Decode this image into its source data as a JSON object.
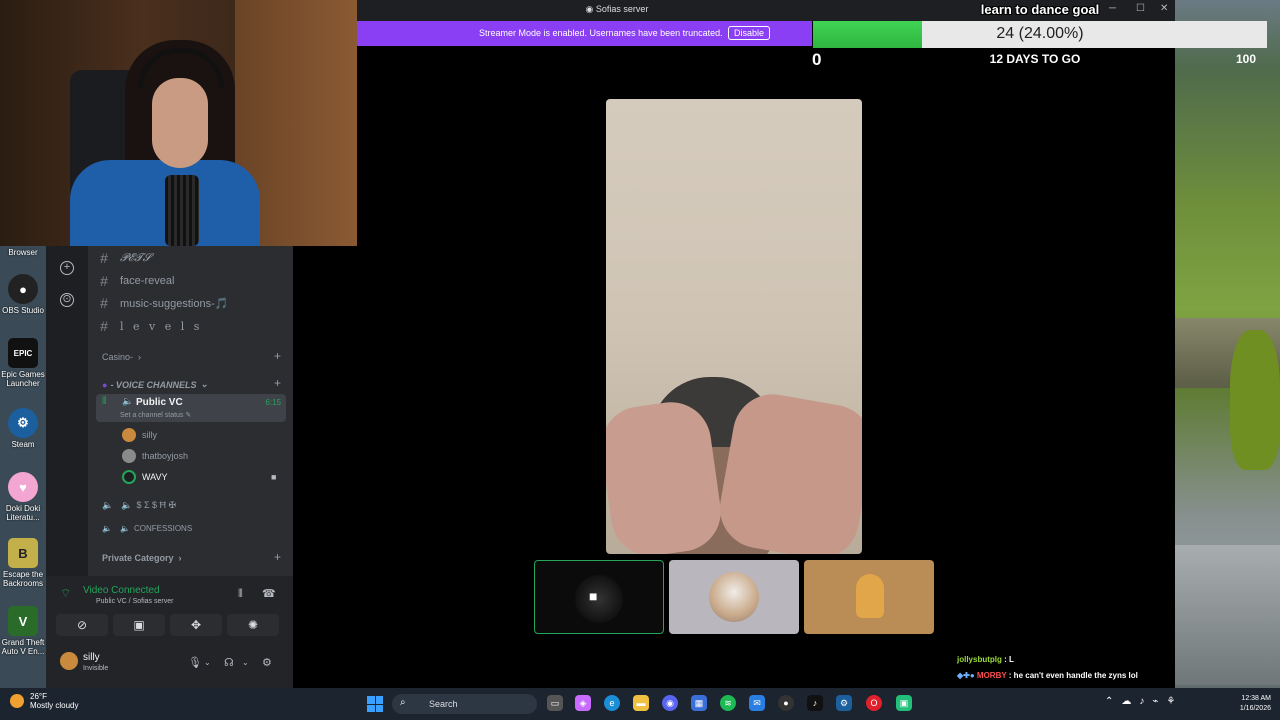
{
  "window": {
    "title": "Sofias server"
  },
  "streamer_banner": {
    "message": "Streamer Mode is enabled. Usernames have been truncated.",
    "disable_label": "Disable"
  },
  "goal": {
    "title": "learn to dance goal",
    "progress_label": "24 (24.00%)",
    "progress_fraction": 0.24,
    "min": "0",
    "max": "100",
    "days_left": "12 DAYS TO GO"
  },
  "channels": [
    {
      "name": "𝓟𝓔𝓣𝓢"
    },
    {
      "name": "face-reveal"
    },
    {
      "name": "music-suggestions-🎵"
    },
    {
      "name": "l e v e l s"
    }
  ],
  "categories": {
    "casino": "Casino-",
    "voice": "- VOICE CHANNELS",
    "private": "Private Category"
  },
  "voice_channel": {
    "name": "Public VC",
    "status_hint": "Set a channel status",
    "duration": "6:15",
    "members": [
      {
        "name": "silly"
      },
      {
        "name": "thatboyjosh"
      },
      {
        "name": "WAVY"
      }
    ]
  },
  "other_voice_channels": [
    {
      "name": "$ Σ $ Ħ ✠"
    },
    {
      "name": "CONFESSIONS"
    }
  ],
  "voice_panel": {
    "status": "Video Connected",
    "location": "Public VC / Sofias server"
  },
  "user": {
    "name": "silly",
    "status": "Invisible"
  },
  "chat": [
    {
      "user": "jollysbutplg",
      "text": ": L"
    },
    {
      "user": "MORBY",
      "text": ": he can't even handle the zyns lol"
    }
  ],
  "desktop_icons": [
    {
      "label": "Browser",
      "icon": "browser-icon"
    },
    {
      "label": "OBS Studio",
      "icon": "obs-icon"
    },
    {
      "label": "Epic Games Launcher",
      "icon": "epic-icon"
    },
    {
      "label": "Steam",
      "icon": "steam-icon"
    },
    {
      "label": "Doki Doki Literatu...",
      "icon": "doki-icon"
    },
    {
      "label": "Escape the Backrooms",
      "icon": "backrooms-icon"
    },
    {
      "label": "Grand Theft Auto V En...",
      "icon": "gta-icon"
    }
  ],
  "taskbar": {
    "weather_temp": "26°F",
    "weather_desc": "Mostly cloudy",
    "search_placeholder": "Search",
    "time": "12:38 AM",
    "date": "1/16/2026"
  },
  "colors": {
    "accent_green": "#23a55a",
    "streamer_purple": "#8b3ff5",
    "goal_green": "#3fd455"
  }
}
